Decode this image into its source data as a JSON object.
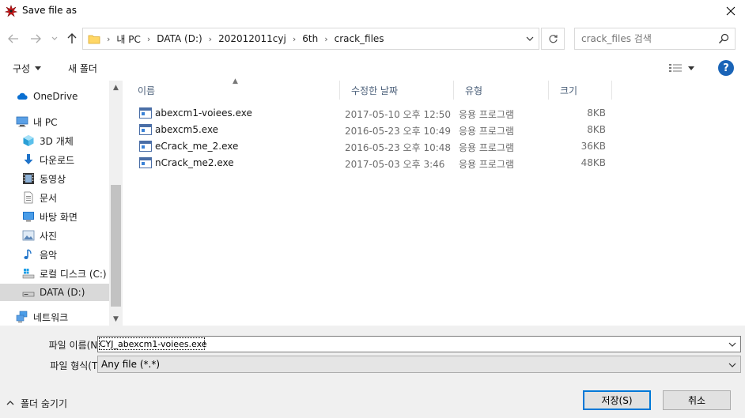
{
  "window": {
    "title": "Save file as",
    "icon": "red-splat-icon"
  },
  "address": {
    "breadcrumbs": [
      "내 PC",
      "DATA (D:)",
      "202012011cyj",
      "6th",
      "crack_files"
    ]
  },
  "search": {
    "placeholder": "crack_files 검색"
  },
  "toolbar": {
    "organize_label": "구성",
    "new_folder_label": "새 폴더"
  },
  "nav": {
    "items": [
      {
        "label": "OneDrive",
        "icon": "cloud-icon"
      },
      {
        "label": "내 PC",
        "icon": "computer-icon"
      },
      {
        "label": "3D 개체",
        "icon": "cube-3d-icon"
      },
      {
        "label": "다운로드",
        "icon": "download-arrow-icon"
      },
      {
        "label": "동영상",
        "icon": "film-icon"
      },
      {
        "label": "문서",
        "icon": "document-icon"
      },
      {
        "label": "바탕 화면",
        "icon": "desktop-icon"
      },
      {
        "label": "사진",
        "icon": "picture-icon"
      },
      {
        "label": "음악",
        "icon": "music-note-icon"
      },
      {
        "label": "로컬 디스크 (C:)",
        "icon": "windows-drive-icon"
      },
      {
        "label": "DATA (D:)",
        "icon": "drive-icon"
      },
      {
        "label": "네트워크",
        "icon": "network-icon"
      }
    ]
  },
  "columns": {
    "name": "이름",
    "date": "수정한 날짜",
    "type": "유형",
    "size": "크기"
  },
  "files": [
    {
      "name": "abexcm1-voiees.exe",
      "date": "2017-05-10 오후 12:50",
      "type": "응용 프로그램",
      "size": "8KB"
    },
    {
      "name": "abexcm5.exe",
      "date": "2016-05-23 오후 10:49",
      "type": "응용 프로그램",
      "size": "8KB"
    },
    {
      "name": "eCrack_me_2.exe",
      "date": "2016-05-23 오후 10:48",
      "type": "응용 프로그램",
      "size": "36KB"
    },
    {
      "name": "nCrack_me2.exe",
      "date": "2017-05-03 오후 3:46",
      "type": "응용 프로그램",
      "size": "48KB"
    }
  ],
  "form": {
    "filename_label": "파일 이름(N):",
    "filename_value": "CYJ_abexcm1-voiees.exe",
    "filetype_label": "파일 형식(T):",
    "filetype_value": "Any file (*.*)"
  },
  "footer": {
    "hide_folders_label": "폴더 숨기기",
    "save_label": "저장(S)",
    "cancel_label": "취소"
  },
  "colors": {
    "accent": "#0078d7",
    "help": "#1a64b7",
    "selected_nav": "#d9d9d9",
    "panel_bg": "#f0f0f0"
  }
}
